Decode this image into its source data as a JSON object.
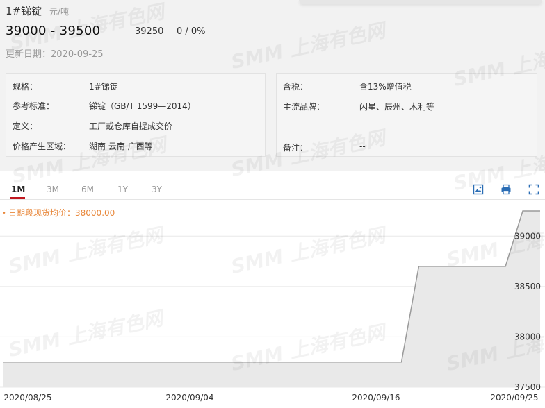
{
  "header": {
    "title": "1#锑锭",
    "unit": "元/吨",
    "price_range": "39000 - 39500",
    "avg_price": "39250",
    "change": "0 / 0%",
    "update_date": "更新日期：2020-09-25"
  },
  "spec_left": [
    {
      "key": "规格：",
      "value": "1#锑锭"
    },
    {
      "key": "参考标准：",
      "value": "锑锭（GB/T 1599—2014）"
    },
    {
      "key": "定义：",
      "value": "工厂或仓库自提成交价"
    },
    {
      "key": "价格产生区域：",
      "value": "湖南 云南 广西等"
    }
  ],
  "spec_right": [
    {
      "key": "含税：",
      "value": "含13%增值税"
    },
    {
      "key": "主流品牌：",
      "value": "闪星、辰州、木利等"
    },
    {
      "key": "备注：",
      "value": "--"
    }
  ],
  "tabs": [
    "1M",
    "3M",
    "6M",
    "1Y",
    "3Y"
  ],
  "active_tab": "1M",
  "tools": [
    "save-image-icon",
    "print-icon",
    "fullscreen-icon"
  ],
  "watermark": "SMM 上海有色网",
  "chart_data": {
    "type": "area",
    "legend": "日期段现货均价：38000.00",
    "x_tick_labels": [
      "2020/08/25",
      "2020/09/04",
      "2020/09/16",
      "2020/09/25"
    ],
    "y_tick_labels": [
      "39000",
      "38500",
      "38000",
      "37500"
    ],
    "ylim": [
      37500,
      39250
    ],
    "x": [
      "2020-08-25",
      "2020-09-17",
      "2020-09-18",
      "2020-09-23",
      "2020-09-24",
      "2020-09-25"
    ],
    "values": [
      37750,
      37750,
      38700,
      38700,
      39250,
      39250
    ],
    "colors": {
      "line": "#9a9a9a",
      "fill": "#e9e9e9",
      "grid": "#e8e8e8"
    }
  }
}
